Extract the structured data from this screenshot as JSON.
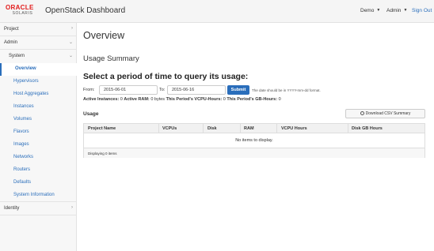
{
  "header": {
    "logo_brand": "ORACLE",
    "logo_sub": "SOLARIS",
    "title": "OpenStack Dashboard",
    "project_menu": "Demo",
    "user_menu": "Admin",
    "sign_out": "Sign Out"
  },
  "sidebar": {
    "project": "Project",
    "admin": "Admin",
    "system": "System",
    "items": [
      "Overview",
      "Hypervisors",
      "Host Aggregates",
      "Instances",
      "Volumes",
      "Flavors",
      "Images",
      "Networks",
      "Routers",
      "Defaults",
      "System Information"
    ],
    "identity": "Identity"
  },
  "main": {
    "page_title": "Overview",
    "section_title": "Usage Summary",
    "period_heading": "Select a period of time to query its usage:",
    "from_label": "From:",
    "from_value": "2015-06-01",
    "to_label": "To:",
    "to_value": "2015-06-16",
    "submit_label": "Submit",
    "date_hint": "The date should be in YYYY-mm-dd format.",
    "stats": {
      "active_instances_label": "Active Instances:",
      "active_instances_value": "0",
      "active_ram_label": "Active RAM:",
      "active_ram_value": "0 bytes",
      "vcpu_hours_label": "This Period's VCPU-Hours:",
      "vcpu_hours_value": "0",
      "gb_hours_label": "This Period's GB-Hours:",
      "gb_hours_value": "0"
    },
    "usage_label": "Usage",
    "download_label": "Download CSV Summary",
    "table": {
      "columns": [
        "Project Name",
        "VCPUs",
        "Disk",
        "RAM",
        "VCPU Hours",
        "Disk GB Hours"
      ],
      "empty_message": "No items to display.",
      "footer": "Displaying 0 items"
    }
  }
}
